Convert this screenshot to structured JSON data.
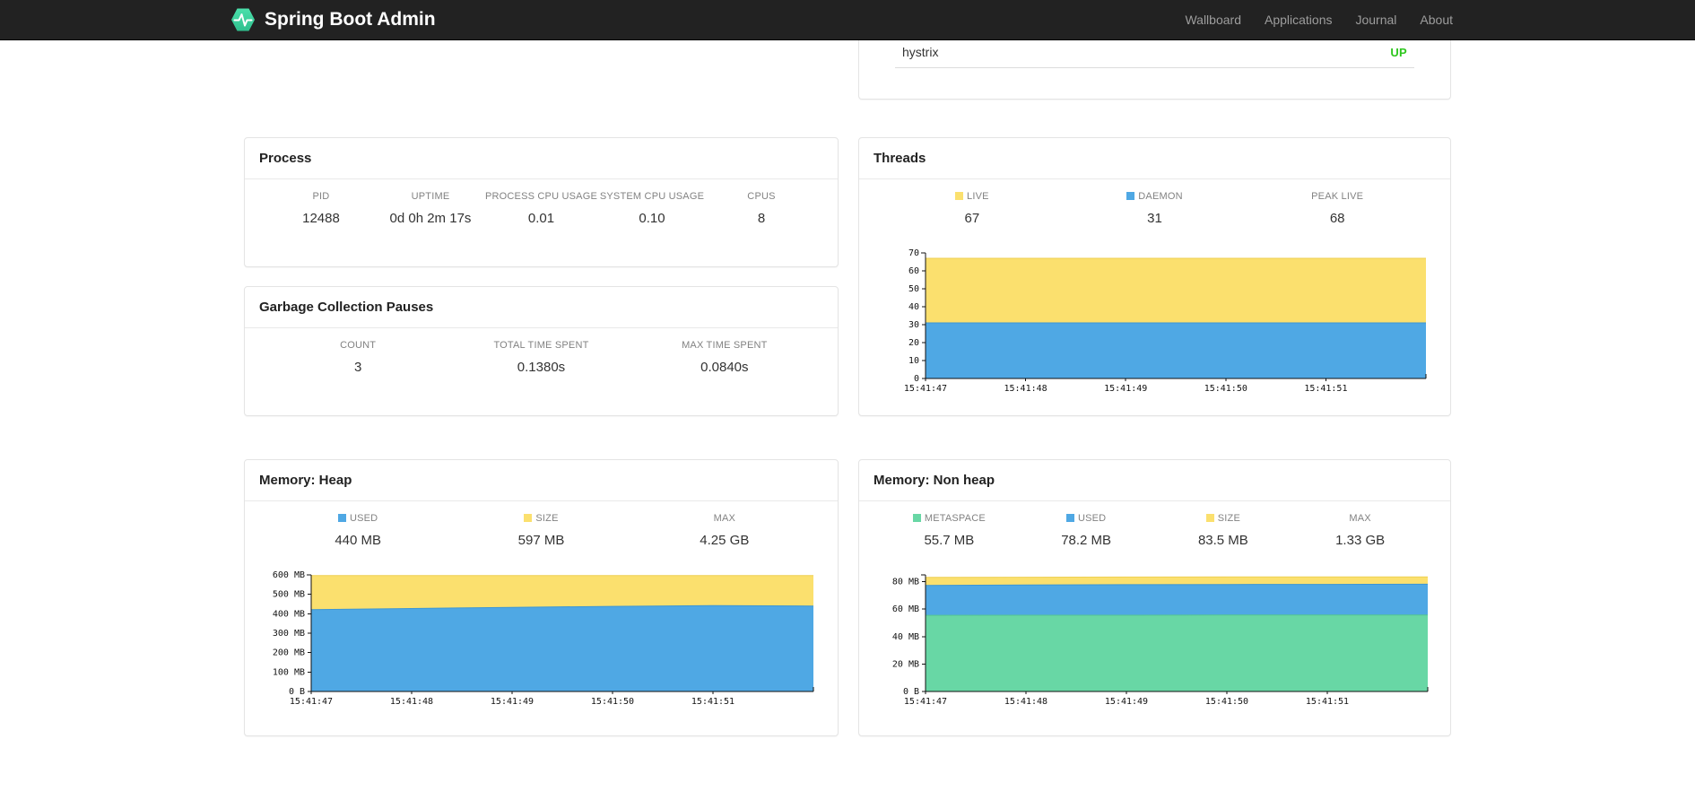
{
  "navbar": {
    "brand": "Spring Boot Admin",
    "links": [
      {
        "label": "Wallboard"
      },
      {
        "label": "Applications"
      },
      {
        "label": "Journal"
      },
      {
        "label": "About"
      }
    ]
  },
  "colors": {
    "navbar_bg": "#222222",
    "brand_green": "#41d6a0",
    "status_up": "#2ec71e",
    "area_yellow": "#fbe06e",
    "area_blue": "#4fa8e4",
    "area_green": "#68d7a5"
  },
  "applications_panel": {
    "name": "hystrix",
    "status": "UP",
    "status_color": "#2ec71e"
  },
  "process": {
    "title": "Process",
    "metrics": [
      {
        "label": "PID",
        "value": "12488"
      },
      {
        "label": "UPTIME",
        "value": "0d 0h 2m 17s"
      },
      {
        "label": "PROCESS CPU USAGE",
        "value": "0.01"
      },
      {
        "label": "SYSTEM CPU USAGE",
        "value": "0.10"
      },
      {
        "label": "CPUS",
        "value": "8"
      }
    ]
  },
  "gc": {
    "title": "Garbage Collection Pauses",
    "metrics": [
      {
        "label": "COUNT",
        "value": "3"
      },
      {
        "label": "TOTAL TIME SPENT",
        "value": "0.1380s"
      },
      {
        "label": "MAX TIME SPENT",
        "value": "0.0840s"
      }
    ]
  },
  "threads": {
    "title": "Threads",
    "legend": [
      {
        "label": "LIVE",
        "value": "67",
        "color": "#fbe06e"
      },
      {
        "label": "DAEMON",
        "value": "31",
        "color": "#4fa8e4"
      },
      {
        "label": "PEAK LIVE",
        "value": "68"
      }
    ]
  },
  "memory_heap": {
    "title": "Memory: Heap",
    "legend": [
      {
        "label": "USED",
        "value": "440 MB",
        "color": "#4fa8e4"
      },
      {
        "label": "SIZE",
        "value": "597 MB",
        "color": "#fbe06e"
      },
      {
        "label": "MAX",
        "value": "4.25 GB"
      }
    ]
  },
  "memory_nonheap": {
    "title": "Memory: Non heap",
    "legend": [
      {
        "label": "METASPACE",
        "value": "55.7 MB",
        "color": "#68d7a5"
      },
      {
        "label": "USED",
        "value": "78.2 MB",
        "color": "#4fa8e4"
      },
      {
        "label": "SIZE",
        "value": "83.5 MB",
        "color": "#fbe06e"
      },
      {
        "label": "MAX",
        "value": "1.33 GB"
      }
    ]
  },
  "chart_data": [
    {
      "id": "threads-chart",
      "type": "area",
      "title": "Threads",
      "xticks": [
        "15:41:47",
        "15:41:48",
        "15:41:49",
        "15:41:50",
        "15:41:51"
      ],
      "ylim": [
        0,
        70
      ],
      "yticks": [
        {
          "v": 70,
          "label": "70"
        },
        {
          "v": 60,
          "label": "60"
        },
        {
          "v": 50,
          "label": "50"
        },
        {
          "v": 40,
          "label": "40"
        },
        {
          "v": 30,
          "label": "30"
        },
        {
          "v": 20,
          "label": "20"
        },
        {
          "v": 10,
          "label": "10"
        },
        {
          "v": 0,
          "label": "0"
        }
      ],
      "series": [
        {
          "name": "LIVE",
          "color": "#fbe06e",
          "stroke": "#eecf52",
          "values": [
            67,
            67,
            67,
            67,
            67,
            67
          ]
        },
        {
          "name": "DAEMON",
          "color": "#4fa8e4",
          "stroke": "#3d96d4",
          "values": [
            31,
            31,
            31,
            31,
            31,
            31
          ]
        }
      ],
      "legend_position": "top"
    },
    {
      "id": "memory-heap-chart",
      "type": "area",
      "title": "Memory: Heap",
      "xticks": [
        "15:41:47",
        "15:41:48",
        "15:41:49",
        "15:41:50",
        "15:41:51"
      ],
      "ylim": [
        0,
        600
      ],
      "yticks": [
        {
          "v": 600,
          "label": "600 MB"
        },
        {
          "v": 500,
          "label": "500 MB"
        },
        {
          "v": 400,
          "label": "400 MB"
        },
        {
          "v": 300,
          "label": "300 MB"
        },
        {
          "v": 200,
          "label": "200 MB"
        },
        {
          "v": 100,
          "label": "100 MB"
        },
        {
          "v": 0,
          "label": "0 B"
        }
      ],
      "series": [
        {
          "name": "SIZE",
          "color": "#fbe06e",
          "stroke": "#eecf52",
          "values": [
            597,
            597,
            597,
            597,
            597,
            597
          ]
        },
        {
          "name": "USED",
          "color": "#4fa8e4",
          "stroke": "#3d96d4",
          "values": [
            421,
            427,
            433,
            438,
            442,
            440
          ]
        }
      ],
      "legend_position": "top"
    },
    {
      "id": "memory-nonheap-chart",
      "type": "area",
      "title": "Memory: Non heap",
      "xticks": [
        "15:41:47",
        "15:41:48",
        "15:41:49",
        "15:41:50",
        "15:41:51"
      ],
      "ylim": [
        0,
        85
      ],
      "yticks": [
        {
          "v": 80,
          "label": "80 MB"
        },
        {
          "v": 60,
          "label": "60 MB"
        },
        {
          "v": 40,
          "label": "40 MB"
        },
        {
          "v": 20,
          "label": "20 MB"
        },
        {
          "v": 0,
          "label": "0 B"
        }
      ],
      "series": [
        {
          "name": "SIZE",
          "color": "#fbe06e",
          "stroke": "#eecf52",
          "values": [
            83.2,
            83.3,
            83.4,
            83.5,
            83.5,
            83.5
          ]
        },
        {
          "name": "USED",
          "color": "#4fa8e4",
          "stroke": "#3d96d4",
          "values": [
            77.3,
            77.6,
            77.9,
            78.0,
            78.1,
            78.2
          ]
        },
        {
          "name": "METASPACE",
          "color": "#68d7a5",
          "stroke": "#54c692",
          "values": [
            55.5,
            55.6,
            55.6,
            55.7,
            55.7,
            55.7
          ]
        }
      ],
      "legend_position": "top"
    }
  ]
}
